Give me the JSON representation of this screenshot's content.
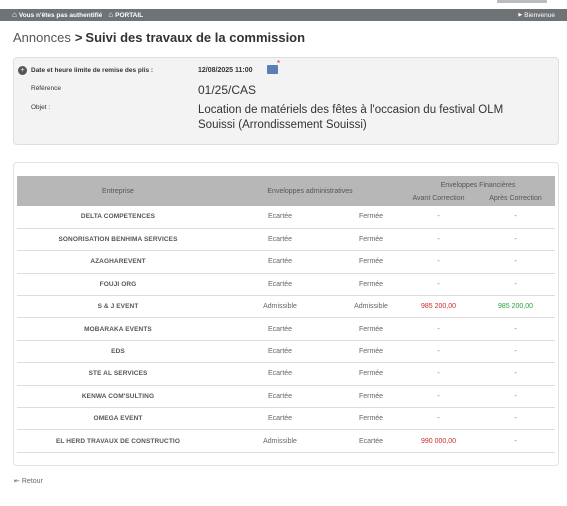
{
  "topbar": {
    "auth_text": "Vous n'êtes pas authentifié",
    "portal_label": "PORTAIL",
    "welcome_label": "Bienvenue"
  },
  "heading": {
    "breadcrumb": "Annonces",
    "separator": ">",
    "title": "Suivi des travaux de la commission"
  },
  "info": {
    "deadline_label": "Date et heure limite de remise des plis :",
    "deadline_value": "12/08/2025 11:00",
    "reference_label": "Référence",
    "reference_value": "01/25/CAS",
    "objet_label": "Objet :",
    "objet_value_line1": "Location de matériels des fêtes à l'occasion du festival OLM",
    "objet_value_line2": "Souissi (Arrondissement Souissi)"
  },
  "table": {
    "headers": {
      "entreprise": "Entreprise",
      "admin": "Enveloppes administratives",
      "financial": "Enveloppes Financières",
      "avant": "Avant Correction",
      "apres": "Après Correction"
    },
    "rows": [
      {
        "entreprise": "DELTA COMPETENCES",
        "admin1": "Ecartée",
        "admin2": "Fermée",
        "avant": "-",
        "apres": "-"
      },
      {
        "entreprise": "SONORISATION BENHIMA SERVICES",
        "admin1": "Ecartée",
        "admin2": "Fermée",
        "avant": "-",
        "apres": "-"
      },
      {
        "entreprise": "AZAGHAREVENT",
        "admin1": "Ecartée",
        "admin2": "Fermée",
        "avant": "-",
        "apres": "-"
      },
      {
        "entreprise": "FOUJI ORG",
        "admin1": "Ecartée",
        "admin2": "Fermée",
        "avant": "-",
        "apres": "-"
      },
      {
        "entreprise": "S & J EVENT",
        "admin1": "Admissible",
        "admin2": "Admissible",
        "avant": "985 200,00",
        "apres": "985 200,00"
      },
      {
        "entreprise": "MOBARAKA EVENTS",
        "admin1": "Ecartée",
        "admin2": "Fermée",
        "avant": "-",
        "apres": "-"
      },
      {
        "entreprise": "EDS",
        "admin1": "Ecartée",
        "admin2": "Fermée",
        "avant": "-",
        "apres": "-"
      },
      {
        "entreprise": "STE AL SERVICES",
        "admin1": "Ecartée",
        "admin2": "Fermée",
        "avant": "-",
        "apres": "-"
      },
      {
        "entreprise": "KENWA COM'SULTING",
        "admin1": "Ecartée",
        "admin2": "Fermée",
        "avant": "-",
        "apres": "-"
      },
      {
        "entreprise": "OMEGA EVENT",
        "admin1": "Ecartée",
        "admin2": "Fermée",
        "avant": "-",
        "apres": "-"
      },
      {
        "entreprise": "EL HERD TRAVAUX DE CONSTRUCTIO",
        "admin1": "Admissible",
        "admin2": "Ecartée",
        "avant": "990 000,00",
        "apres": "-"
      }
    ]
  },
  "footer": {
    "retour_label": "Retour"
  },
  "colors": {
    "topbar_bg": "#6e7378",
    "table_header_bg": "#b7b7b7",
    "amount_avant": "#cc2b2b",
    "amount_apres": "#2aa13a"
  }
}
